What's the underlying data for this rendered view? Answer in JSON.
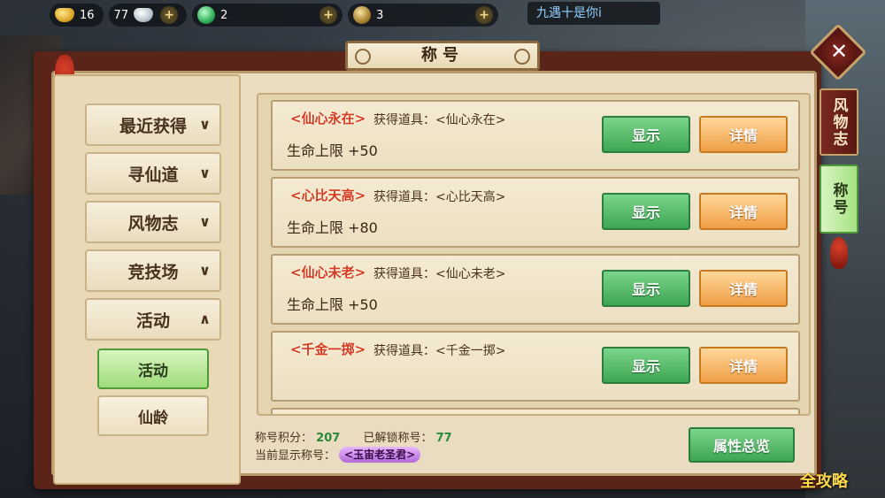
{
  "topbar": {
    "gold": "16",
    "silver": "77",
    "jade": "2",
    "bag": "3",
    "plus": "+",
    "chat": "九遇十是你i"
  },
  "panel": {
    "title": "称号"
  },
  "categories": [
    {
      "label": "最近获得",
      "chevron": "∨"
    },
    {
      "label": "寻仙道",
      "chevron": "∨"
    },
    {
      "label": "风物志",
      "chevron": "∨"
    },
    {
      "label": "竞技场",
      "chevron": "∨"
    },
    {
      "label": "活动",
      "chevron": "∧"
    }
  ],
  "subcategories": [
    {
      "label": "活动",
      "selected": true
    },
    {
      "label": "仙龄",
      "selected": false
    }
  ],
  "titles": [
    {
      "tag": "<仙心永在>",
      "got": "获得道具：<仙心永在>",
      "stat": "生命上限 +50",
      "show": "显示",
      "detail": "详情"
    },
    {
      "tag": "<心比天高>",
      "got": "获得道具：<心比天高>",
      "stat": "生命上限 +80",
      "show": "显示",
      "detail": "详情"
    },
    {
      "tag": "<仙心未老>",
      "got": "获得道具：<仙心未老>",
      "stat": "生命上限 +50",
      "show": "显示",
      "detail": "详情"
    },
    {
      "tag": "<千金一掷>",
      "got": "获得道具：<千金一掷>",
      "stat": "",
      "show": "显示",
      "detail": "详情"
    }
  ],
  "footer": {
    "score_label": "称号积分：",
    "score": "207",
    "unlocked_label": "已解锁称号：",
    "unlocked": "77",
    "current_label": "当前显示称号：",
    "current": "<玉宙老圣君>",
    "attr_button": "属性总览"
  },
  "sidetabs": {
    "tab1": "风物志",
    "tab2": "称号",
    "close": "✕"
  },
  "watermark": "全攻略",
  "colors": {
    "green_btn": "#3ea652",
    "orange_btn": "#ef9f45",
    "frame": "#5a2418",
    "parchment": "#e9dcc0"
  }
}
